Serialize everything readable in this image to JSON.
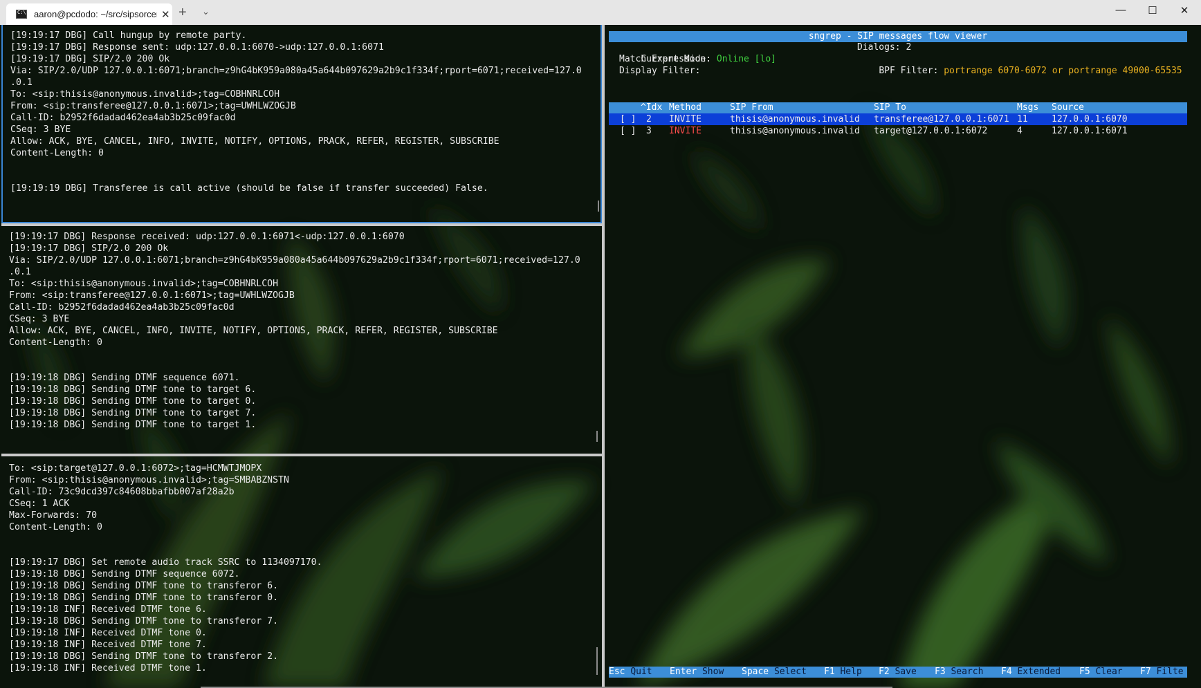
{
  "window": {
    "tab_title": "aaron@pcdodo: ~/src/sipsorcer",
    "tab_close": "✕",
    "new_tab": "+",
    "tab_menu": "⌄",
    "minimize": "—",
    "maximize": "☐",
    "close": "✕"
  },
  "pane1": {
    "lines": [
      "[19:19:17 DBG] Call hungup by remote party.",
      "[19:19:17 DBG] Response sent: udp:127.0.0.1:6070->udp:127.0.0.1:6071",
      "[19:19:17 DBG] SIP/2.0 200 Ok",
      "Via: SIP/2.0/UDP 127.0.0.1:6071;branch=z9hG4bK959a080a45a644b097629a2b9c1f334f;rport=6071;received=127.0",
      ".0.1",
      "To: <sip:thisis@anonymous.invalid>;tag=COBHNRLCOH",
      "From: <sip:transferee@127.0.0.1:6071>;tag=UWHLWZOGJB",
      "Call-ID: b2952f6dadad462ea4ab3b25c09fac0d",
      "CSeq: 3 BYE",
      "Allow: ACK, BYE, CANCEL, INFO, INVITE, NOTIFY, OPTIONS, PRACK, REFER, REGISTER, SUBSCRIBE",
      "Content-Length: 0",
      "",
      "",
      "[19:19:19 DBG] Transferee is call active (should be false if transfer succeeded) False."
    ]
  },
  "pane2": {
    "lines": [
      "[19:19:17 DBG] Response received: udp:127.0.0.1:6071<-udp:127.0.0.1:6070",
      "[19:19:17 DBG] SIP/2.0 200 Ok",
      "Via: SIP/2.0/UDP 127.0.0.1:6071;branch=z9hG4bK959a080a45a644b097629a2b9c1f334f;rport=6071;received=127.0",
      ".0.1",
      "To: <sip:thisis@anonymous.invalid>;tag=COBHNRLCOH",
      "From: <sip:transferee@127.0.0.1:6071>;tag=UWHLWZOGJB",
      "Call-ID: b2952f6dadad462ea4ab3b25c09fac0d",
      "CSeq: 3 BYE",
      "Allow: ACK, BYE, CANCEL, INFO, INVITE, NOTIFY, OPTIONS, PRACK, REFER, REGISTER, SUBSCRIBE",
      "Content-Length: 0",
      "",
      "",
      "[19:19:18 DBG] Sending DTMF sequence 6071.",
      "[19:19:18 DBG] Sending DTMF tone to target 6.",
      "[19:19:18 DBG] Sending DTMF tone to target 0.",
      "[19:19:18 DBG] Sending DTMF tone to target 7.",
      "[19:19:18 DBG] Sending DTMF tone to target 1."
    ]
  },
  "pane3": {
    "lines": [
      "To: <sip:target@127.0.0.1:6072>;tag=HCMWTJMOPX",
      "From: <sip:thisis@anonymous.invalid>;tag=SMBABZNSTN",
      "Call-ID: 73c9dcd397c84608bbafbb007af28a2b",
      "CSeq: 1 ACK",
      "Max-Forwards: 70",
      "Content-Length: 0",
      "",
      "",
      "[19:19:17 DBG] Set remote audio track SSRC to 1134097170.",
      "[19:19:18 DBG] Sending DTMF sequence 6072.",
      "[19:19:18 DBG] Sending DTMF tone to transferor 6.",
      "[19:19:18 DBG] Sending DTMF tone to transferor 0.",
      "[19:19:18 INF] Received DTMF tone 6.",
      "[19:19:18 DBG] Sending DTMF tone to transferor 7.",
      "[19:19:18 INF] Received DTMF tone 0.",
      "[19:19:18 INF] Received DTMF tone 7.",
      "[19:19:18 DBG] Sending DTMF tone to transferor 2.",
      "[19:19:18 INF] Received DTMF tone 1."
    ]
  },
  "sngrep": {
    "title": "sngrep - SIP messages flow viewer",
    "mode_label": "Current Mode:",
    "mode_value": "Online [lo]",
    "dialogs": "Dialogs: 2",
    "match_label": "Match Expression:",
    "bpf_label": "BPF Filter:",
    "bpf_value": "portrange 6070-6072 or portrange 49000-65535",
    "display_label": "Display Filter:",
    "columns": {
      "idx": "^Idx",
      "method": "Method",
      "from": "SIP From",
      "to": "SIP To",
      "msgs": "Msgs",
      "source": "Source"
    },
    "rows": [
      {
        "check": "[ ]",
        "idx": "2",
        "method": "INVITE",
        "from": "thisis@anonymous.invalid",
        "to": "transferee@127.0.0.1:6071",
        "msgs": "11",
        "source": "127.0.0.1:6070"
      },
      {
        "check": "[ ]",
        "idx": "3",
        "method": "INVITE",
        "from": "thisis@anonymous.invalid",
        "to": "target@127.0.0.1:6072",
        "msgs": "4",
        "source": "127.0.0.1:6071"
      }
    ],
    "footer": [
      {
        "key": "Esc",
        "label": "Quit"
      },
      {
        "key": "Enter",
        "label": "Show"
      },
      {
        "key": "Space",
        "label": "Select"
      },
      {
        "key": "F1",
        "label": "Help"
      },
      {
        "key": "F2",
        "label": "Save"
      },
      {
        "key": "F3",
        "label": "Search"
      },
      {
        "key": "F4",
        "label": "Extended"
      },
      {
        "key": "F5",
        "label": "Clear"
      },
      {
        "key": "F7",
        "label": "Filte"
      }
    ]
  },
  "colors": {
    "accent": "#3c8ed8",
    "selected_row": "#0c3fd8",
    "online": "#3fcf3f",
    "bpf": "#e8b020",
    "invite_unselected": "#ff4c4c"
  }
}
